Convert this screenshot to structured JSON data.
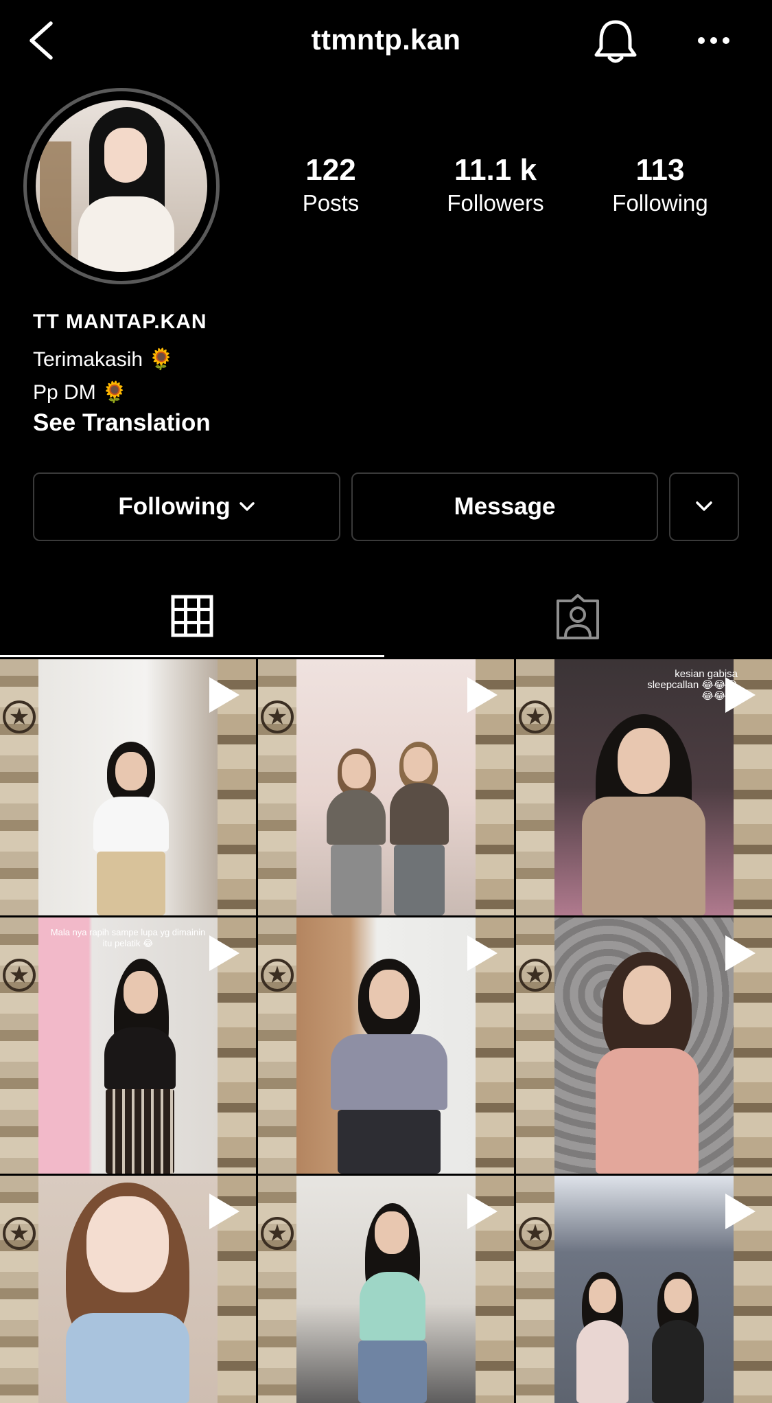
{
  "header": {
    "username": "ttmntp.kan",
    "icons": {
      "back": "chevron-left-icon",
      "notifications": "bell-icon",
      "more": "more-horizontal-icon"
    }
  },
  "profile": {
    "avatar": "profile-avatar",
    "stats": [
      {
        "value": "122",
        "label": "Posts"
      },
      {
        "value": "11.1 k",
        "label": "Followers"
      },
      {
        "value": "113",
        "label": "Following"
      }
    ],
    "full_name": "TT MANTAP.KAN",
    "bio": [
      "Terimakasih 🌻",
      "Pp DM 🌻"
    ],
    "see_translation": "See Translation"
  },
  "actions": {
    "following_label": "Following",
    "message_label": "Message"
  },
  "tabs": [
    {
      "name": "posts-grid",
      "icon": "grid-icon",
      "active": true
    },
    {
      "name": "tagged",
      "icon": "tagged-person-icon",
      "active": false
    }
  ],
  "posts": {
    "overlay_texts": {
      "post3": "kesian gabisa sleepcallan 😂😂😂😂😂😂",
      "post4": "Mala nya rapih sampe lupa yg dimainin itu pelatik 😂"
    },
    "count_visible": 9,
    "type": "video"
  },
  "colors": {
    "background": "#000000",
    "text": "#ffffff",
    "border": "#3a3a3a"
  }
}
